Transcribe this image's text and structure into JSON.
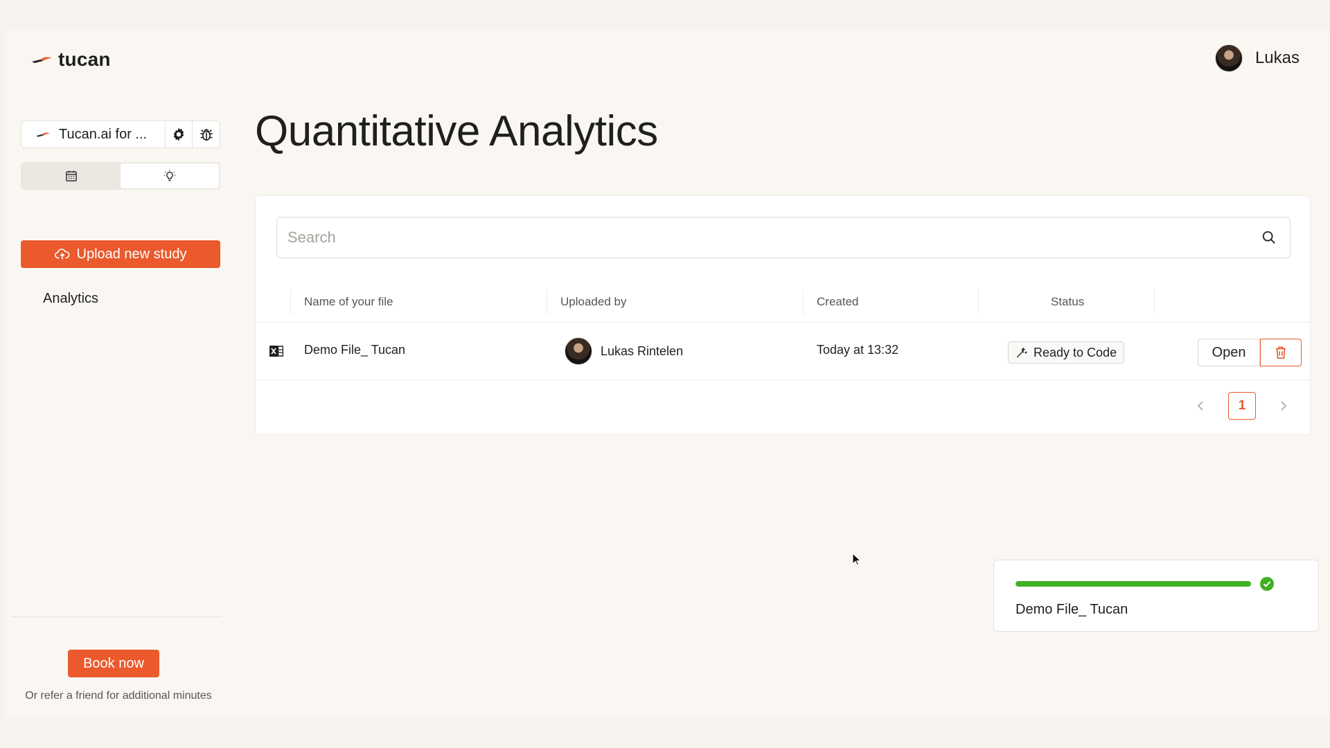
{
  "header": {
    "logo_text": "tucan",
    "user_name": "Lukas"
  },
  "sidebar": {
    "workspace_name": "Tucan.ai for ...",
    "upload_label": "Upload new study",
    "nav_items": [
      {
        "label": "Analytics"
      }
    ],
    "book_label": "Book now",
    "refer_text": "Or refer a friend for additional minutes"
  },
  "main": {
    "title": "Quantitative Analytics",
    "search": {
      "placeholder": "Search",
      "value": ""
    },
    "columns": [
      "Name of your file",
      "Uploaded by",
      "Created",
      "Status"
    ],
    "rows": [
      {
        "file_name": "Demo File_ Tucan",
        "uploaded_by": "Lukas Rintelen",
        "created": "Today at 13:32",
        "status": "Ready to Code",
        "open_label": "Open"
      }
    ],
    "pagination": {
      "current_page": "1"
    }
  },
  "upload_toast": {
    "file_name": "Demo File_ Tucan",
    "progress_percent": 100
  },
  "colors": {
    "accent": "#ea5a2c",
    "success": "#3fb023",
    "background": "#faf7f2"
  },
  "icons": [
    "tucan-logo-icon",
    "gear-icon",
    "bug-icon",
    "calendar-icon",
    "lightbulb-icon",
    "cloud-upload-icon",
    "search-icon",
    "excel-file-icon",
    "magic-wand-icon",
    "trash-icon",
    "chevron-left-icon",
    "chevron-right-icon",
    "check-circle-icon",
    "cursor-icon"
  ]
}
